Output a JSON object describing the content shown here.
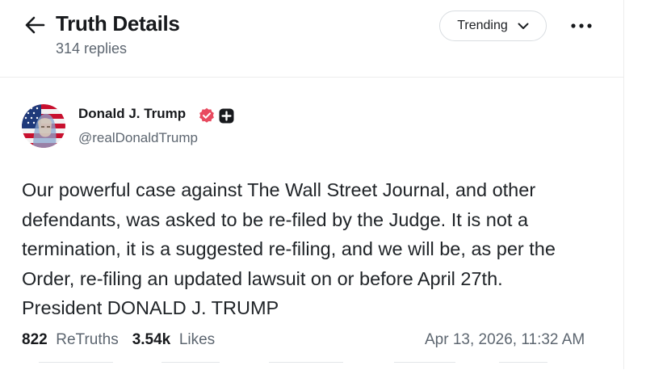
{
  "header": {
    "title": "Truth Details",
    "reply_count": "314 replies",
    "sort_label": "Trending"
  },
  "post": {
    "author": {
      "display_name": "Donald J. Trump",
      "handle": "@realDonaldTrump",
      "verified": true
    },
    "body": "Our powerful case against The Wall Street Journal, and other\ndefendants, was asked to be re-filed by the Judge. It is not a\ntermination, it is a suggested re-filing, and we will be, as per the\nOrder, re-filing an updated lawsuit on or before April 27th.\nPresident DONALD J. TRUMP",
    "stats": {
      "retruths_count": "822",
      "retruths_label": "ReTruths",
      "likes_count": "3.54k",
      "likes_label": "Likes"
    },
    "timestamp": "Apr 13, 2026, 11:32 AM"
  },
  "colors": {
    "accent": "#e84a5f",
    "text_primary": "#17191c",
    "text_secondary": "#5d6670",
    "border": "#ececec"
  },
  "icons": {
    "back": "arrow-left-icon",
    "sort": "chevron-down-icon",
    "more": "more-horizontal-icon",
    "verified": "verified-badge-icon",
    "plus": "plus-badge-icon"
  }
}
